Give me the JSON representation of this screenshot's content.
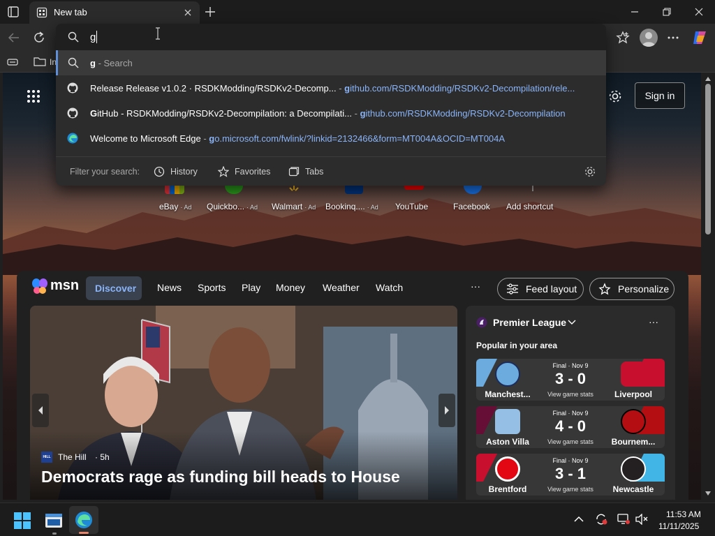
{
  "browser": {
    "tab_title": "New tab",
    "address_value": "g",
    "sign_in_label": "Sign in",
    "favorites_partial": "In"
  },
  "omnibox": {
    "suggestions": [
      {
        "icon": "search-icon",
        "bold": "g",
        "text": " - Search",
        "url_bold": "",
        "url": ""
      },
      {
        "icon": "github-icon",
        "bold": "",
        "text": "Release Release v1.0.2 · RSDKModding/RSDKv2-Decomp...",
        "url_bold": "g",
        "url": "ithub.com/RSDKModding/RSDKv2-Decompilation/rele..."
      },
      {
        "icon": "github-icon",
        "bold": "G",
        "text": "itHub - RSDKModding/RSDKv2-Decompilation: a Decompilati...",
        "url_bold": "g",
        "url": "ithub.com/RSDKModding/RSDKv2-Decompilation"
      },
      {
        "icon": "edge-icon",
        "bold": "",
        "text": "Welcome to Microsoft Edge",
        "url_bold": "g",
        "url": "o.microsoft.com/fwlink/?linkid=2132466&form=MT004A&OCID=MT004A"
      }
    ],
    "separator": " - ",
    "filter_label": "Filter your search:",
    "filters": [
      "History",
      "Favorites",
      "Tabs"
    ]
  },
  "shortcuts": [
    {
      "label": "eBay",
      "ad": "Ad"
    },
    {
      "label": "Quickbo...",
      "ad": "Ad"
    },
    {
      "label": "Walmart",
      "ad": "Ad"
    },
    {
      "label": "Bookinq....",
      "ad": "Ad"
    },
    {
      "label": "YouTube",
      "ad": ""
    },
    {
      "label": "Facebook",
      "ad": ""
    },
    {
      "label": "Add shortcut",
      "ad": ""
    }
  ],
  "msn": {
    "brand": "msn",
    "nav": [
      "Discover",
      "News",
      "Sports",
      "Play",
      "Money",
      "Weather",
      "Watch"
    ],
    "more": "···",
    "feed_layout": "Feed layout",
    "personalize": "Personalize"
  },
  "hero": {
    "source": "The Hill",
    "time": "· 5h",
    "source_logo": "HILL",
    "headline": "Democrats rage as funding bill heads to House"
  },
  "sports": {
    "league": "Premier League",
    "subtitle": "Popular in your area",
    "more": "···",
    "matches": [
      {
        "home": "Manchest...",
        "away": "Liverpool",
        "status": "Final · Nov 9",
        "score": "3 - 0",
        "stats": "View game stats",
        "home_color": "#6cabdd",
        "away_color": "#c8102e"
      },
      {
        "home": "Aston Villa",
        "away": "Bournem...",
        "status": "Final · Nov 9",
        "score": "4 - 0",
        "stats": "View game stats",
        "home_color": "#670e36",
        "away_color": "#b50e12"
      },
      {
        "home": "Brentford",
        "away": "Newcastle",
        "status": "Final · Nov 9",
        "score": "3 - 1",
        "stats": "View game stats",
        "home_color": "#c8102e",
        "away_color": "#41b6e6"
      }
    ]
  },
  "taskbar": {
    "time": "11:53 AM",
    "date": "11/11/2025"
  },
  "colors": {
    "accent_link": "#8ab4f8",
    "discover_bg": "#3a4250"
  }
}
